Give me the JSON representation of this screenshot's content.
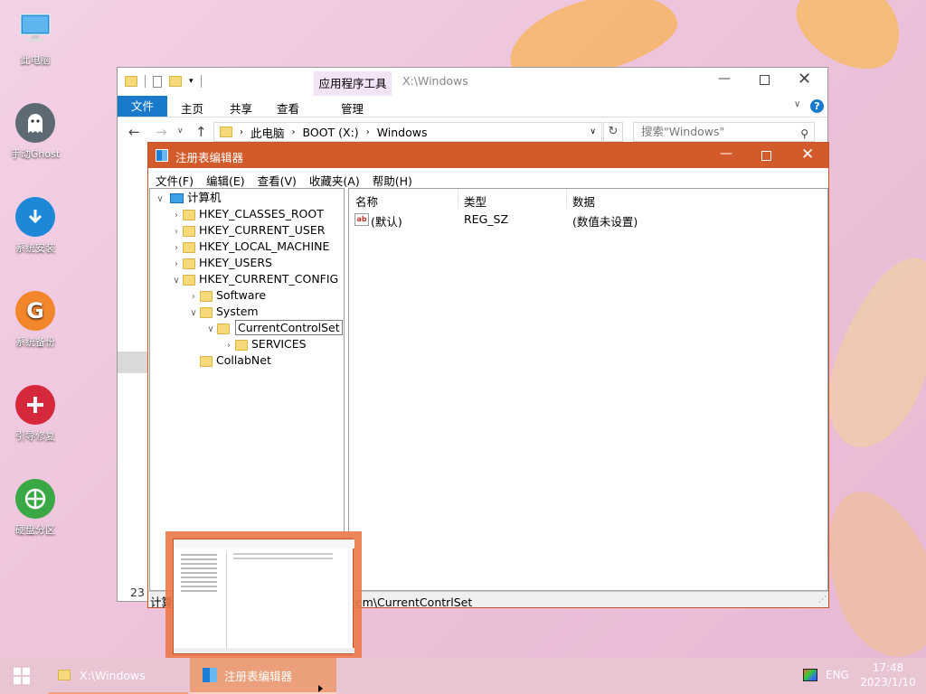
{
  "desktop_icons": [
    {
      "label": "此电脑",
      "icon": "computer-icon"
    },
    {
      "label": "手动Ghost",
      "icon": "ghost-icon"
    },
    {
      "label": "系统安装",
      "icon": "download-icon"
    },
    {
      "label": "系统备份",
      "icon": "backup-icon"
    },
    {
      "label": "引导修复",
      "icon": "repair-icon"
    },
    {
      "label": "硬盘分区",
      "icon": "partition-icon"
    }
  ],
  "explorer": {
    "title": "X:\\Windows",
    "context_tab_group": "应用程序工具",
    "ribbon_tabs": [
      "文件",
      "主页",
      "共享",
      "查看",
      "管理"
    ],
    "breadcrumb": [
      "此电脑",
      "BOOT (X:)",
      "Windows"
    ],
    "search_placeholder": "搜索\"Windows\"",
    "status_count": "23"
  },
  "regedit": {
    "title": "注册表编辑器",
    "menu": [
      "文件(F)",
      "编辑(E)",
      "查看(V)",
      "收藏夹(A)",
      "帮助(H)"
    ],
    "tree": {
      "root": "计算机",
      "hives": [
        "HKEY_CLASSES_ROOT",
        "HKEY_CURRENT_USER",
        "HKEY_LOCAL_MACHINE",
        "HKEY_USERS",
        "HKEY_CURRENT_CONFIG"
      ],
      "software": "Software",
      "system": "System",
      "selected": "CurrentControlSet",
      "services": "SERVICES",
      "collabnet": "CollabNet"
    },
    "columns": [
      "名称",
      "类型",
      "数据"
    ],
    "values": [
      {
        "name": "(默认)",
        "type": "REG_SZ",
        "data": "(数值未设置)"
      }
    ],
    "status_path": "计算机\\HKEY_CURRENT_CONFIG\\System\\CurrentContrlSet"
  },
  "taskbar": {
    "items": [
      "X:\\Windows",
      "注册表编辑器"
    ],
    "lang": "ENG",
    "time": "17:48",
    "date": "2023/1/10"
  },
  "colors": {
    "accent_blue": "#0078d7",
    "regedit_title": "#d35a2a",
    "context_tab": "#f3e3f7"
  }
}
